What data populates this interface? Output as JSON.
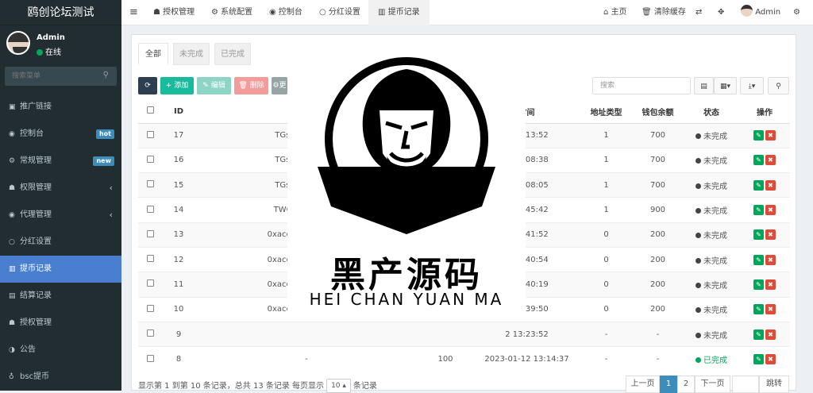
{
  "app": {
    "title": "鸥创论坛测试"
  },
  "user": {
    "name": "Admin",
    "status": "在线"
  },
  "search": {
    "placeholder": "搜索菜单"
  },
  "menu": [
    {
      "icon": "share-icon",
      "glyph": "▣",
      "label": "推广链接",
      "badge": "",
      "arrow": false,
      "active": false
    },
    {
      "icon": "dashboard-icon",
      "glyph": "◉",
      "label": "控制台",
      "badge": "hot",
      "arrow": false,
      "active": false
    },
    {
      "icon": "cogs-icon",
      "glyph": "⚙",
      "label": "常规管理",
      "badge": "new",
      "arrow": false,
      "active": false
    },
    {
      "icon": "group-icon",
      "glyph": "☗",
      "label": "权限管理",
      "badge": "",
      "arrow": true,
      "active": false
    },
    {
      "icon": "user-circle-icon",
      "glyph": "◉",
      "label": "代理管理",
      "badge": "",
      "arrow": true,
      "active": false
    },
    {
      "icon": "circle-icon",
      "glyph": "○",
      "label": "分红设置",
      "badge": "",
      "arrow": false,
      "active": false
    },
    {
      "icon": "chart-icon",
      "glyph": "▥",
      "label": "提币记录",
      "badge": "",
      "arrow": false,
      "active": true
    },
    {
      "icon": "table-icon",
      "glyph": "▤",
      "label": "结算记录",
      "badge": "",
      "arrow": false,
      "active": false
    },
    {
      "icon": "group-icon",
      "glyph": "☗",
      "label": "授权管理",
      "badge": "",
      "arrow": false,
      "active": false
    },
    {
      "icon": "half-circle-icon",
      "glyph": "◑",
      "label": "公告",
      "badge": "",
      "arrow": false,
      "active": false
    },
    {
      "icon": "bicycle-icon",
      "glyph": "♁",
      "label": "bsc提币",
      "badge": "",
      "arrow": false,
      "active": false
    }
  ],
  "topnav": {
    "tabs": [
      "授权管理",
      "系统配置",
      "控制台",
      "分红设置",
      "提币记录"
    ],
    "home": "主页",
    "clear_cache": "清除缓存",
    "admin": "Admin"
  },
  "content_tabs": [
    "全部",
    "未完成",
    "已完成"
  ],
  "toolbar": {
    "add": "添加",
    "edit": "编辑",
    "delete": "删除",
    "more": "更",
    "search_placeholder": "搜索"
  },
  "table": {
    "headers": [
      "ID",
      "",
      "",
      "时间",
      "地址类型",
      "钱包余额",
      "状态",
      "操作"
    ],
    "rows": [
      {
        "id": "17",
        "addr": "TGsrEbD5Rr7sA",
        "amount": "",
        "time": "5 18:13:52",
        "type": "1",
        "balance": "700",
        "status": "未完成",
        "done": false
      },
      {
        "id": "16",
        "addr": "TGsrEbD5Rr7sA",
        "amount": "",
        "time": "5 18:08:38",
        "type": "1",
        "balance": "700",
        "status": "未完成",
        "done": false
      },
      {
        "id": "15",
        "addr": "TGsrEbD5Rr7sA",
        "amount": "",
        "time": "5 18:08:05",
        "type": "1",
        "balance": "700",
        "status": "未完成",
        "done": false
      },
      {
        "id": "14",
        "addr": "TWCau5UAA5nV",
        "amount": "",
        "time": "3 13:45:42",
        "type": "1",
        "balance": "900",
        "status": "未完成",
        "done": false
      },
      {
        "id": "13",
        "addr": "0xaccea99712d0ed",
        "amount": "",
        "time": "2 19:41:52",
        "type": "0",
        "balance": "200",
        "status": "未完成",
        "done": false
      },
      {
        "id": "12",
        "addr": "0xaccea99712d0ed",
        "amount": "",
        "time": "2 19:40:54",
        "type": "0",
        "balance": "200",
        "status": "未完成",
        "done": false
      },
      {
        "id": "11",
        "addr": "0xaccea99712d0ed",
        "amount": "",
        "time": "2 19:40:19",
        "type": "0",
        "balance": "200",
        "status": "未完成",
        "done": false
      },
      {
        "id": "10",
        "addr": "0xaccea99712d0ed",
        "amount": "",
        "time": "2 19:39:50",
        "type": "0",
        "balance": "200",
        "status": "未完成",
        "done": false
      },
      {
        "id": "9",
        "addr": "",
        "amount": "",
        "time": "2 13:23:52",
        "type": "-",
        "balance": "-",
        "status": "未完成",
        "done": false
      },
      {
        "id": "8",
        "addr": "-",
        "amount": "100",
        "time": "2023-01-12 13:14:37",
        "type": "-",
        "balance": "-",
        "status": "已完成",
        "done": true
      }
    ]
  },
  "footer": {
    "text_a": "显示第 1 到第 10 条记录，总共 13 条记录 每页显示",
    "per_page": "10",
    "text_b": "条记录",
    "prev": "上一页",
    "p1": "1",
    "p2": "2",
    "next": "下一页",
    "goto": "跳转"
  },
  "watermark": {
    "cn": "黑产源码",
    "en": "HEI CHAN YUAN MA"
  },
  "colors": {
    "sidebar": "#222d32",
    "active": "#4a7fcf",
    "green": "#00a65a",
    "red": "#dd4b39",
    "teal": "#1abc9c",
    "salmon": "#f39c9c"
  }
}
